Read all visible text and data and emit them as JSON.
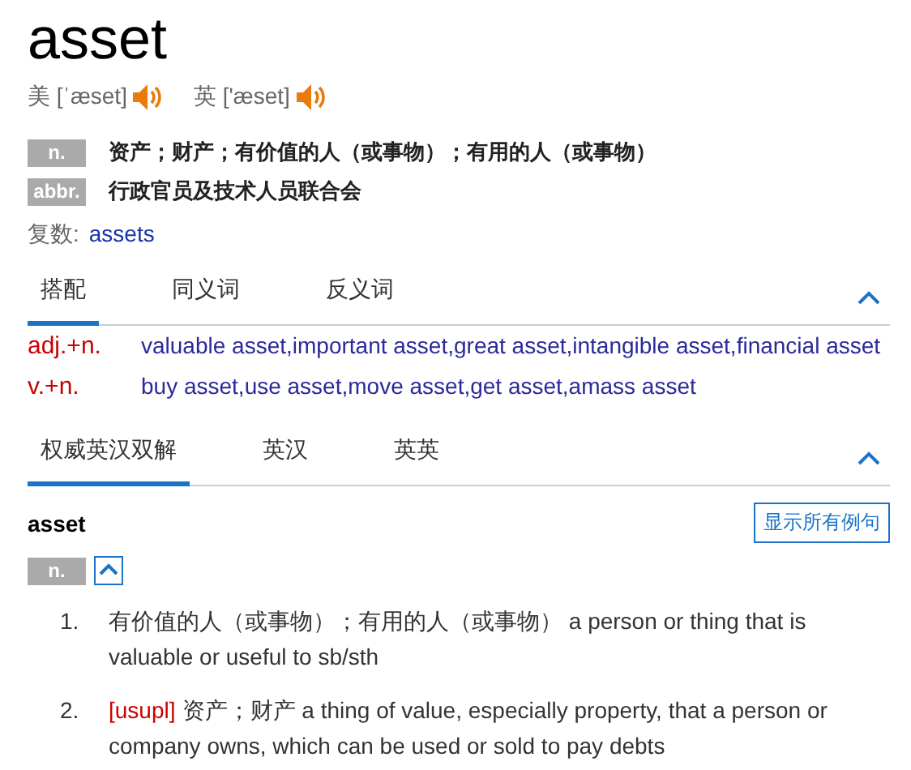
{
  "headword": "asset",
  "pronunciations": [
    {
      "region": "美",
      "phonetic": "[ˈæset]"
    },
    {
      "region": "英",
      "phonetic": "['æset]"
    }
  ],
  "senses": [
    {
      "pos": "n.",
      "meaning": "资产；财产；有价值的人（或事物）；有用的人（或事物）"
    },
    {
      "pos": "abbr.",
      "meaning": "行政官员及技术人员联合会"
    }
  ],
  "plural": {
    "label": "复数:",
    "value": "assets"
  },
  "collocation_tabs": [
    {
      "label": "搭配",
      "selected": true
    },
    {
      "label": "同义词",
      "selected": false
    },
    {
      "label": "反义词",
      "selected": false
    }
  ],
  "collocations": [
    {
      "pattern": "adj.+n.",
      "examples": "valuable asset,important asset,great asset,intangible asset,financial asset"
    },
    {
      "pattern": "v.+n.",
      "examples": "buy asset,use asset,move asset,get asset,amass asset"
    }
  ],
  "definition_tabs": [
    {
      "label": "权威英汉双解",
      "selected": true
    },
    {
      "label": "英汉",
      "selected": false
    },
    {
      "label": "英英",
      "selected": false
    }
  ],
  "entry": {
    "word": "asset",
    "show_examples_button": "显示所有例句",
    "pos": "n.",
    "definitions": [
      {
        "number": "1.",
        "text": "有价值的人（或事物）；有用的人（或事物） a person or thing that is valuable or useful to sb/sth"
      },
      {
        "number": "2.",
        "grammar": "[usupl]",
        "text": "资产；财产 a thing of value, especially property, that a person or company owns, which can be used or sold to pay debts"
      }
    ]
  }
}
